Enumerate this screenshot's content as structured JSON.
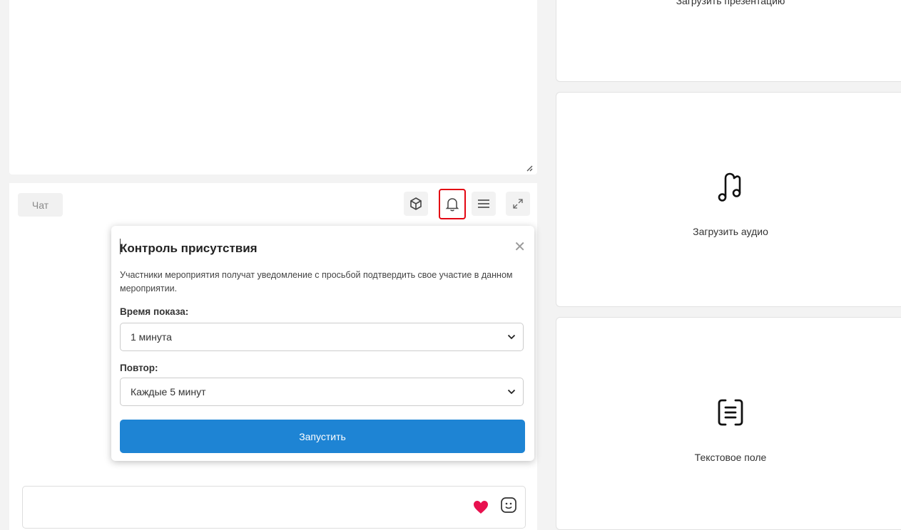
{
  "editor": {},
  "chat": {
    "tab_label": "Чат",
    "toolbar": [
      {
        "name": "cube-icon"
      },
      {
        "name": "bell-icon",
        "highlighted": true
      },
      {
        "name": "menu-icon"
      },
      {
        "name": "expand-icon"
      }
    ]
  },
  "presence_popover": {
    "title": "Контроль присутствия",
    "description": "Участники мероприятия получат уведомление с просьбой подтвердить свое участие в данном мероприятии.",
    "show_time_label": "Время показа:",
    "show_time_value": "1 минута",
    "repeat_label": "Повтор:",
    "repeat_value": "Каждые 5 минут",
    "start_button": "Запустить"
  },
  "message_input": {
    "heart_color": "#e8114f",
    "icons": [
      "heart-icon",
      "emoji-icon"
    ]
  },
  "right_cards": [
    {
      "label": "Загрузить презентацию",
      "icon": "presentation-icon"
    },
    {
      "label": "Загрузить аудио",
      "icon": "music-note-icon"
    },
    {
      "label": "Текстовое поле",
      "icon": "text-field-icon"
    }
  ],
  "colors": {
    "accent": "#1e84d4",
    "highlight_border": "#e30613"
  }
}
